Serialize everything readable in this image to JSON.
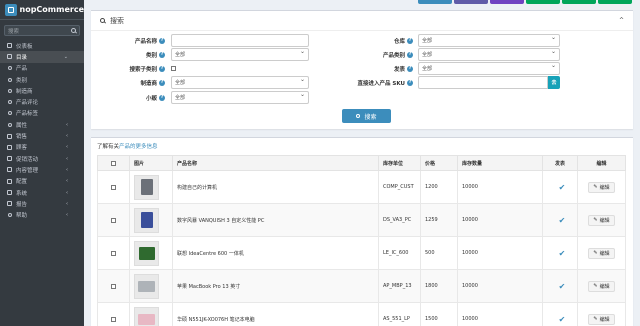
{
  "brand": {
    "name": "nopCommerce"
  },
  "sidebar": {
    "search_placeholder": "搜索",
    "items": [
      {
        "label": "仪表板",
        "chevron": ""
      },
      {
        "label": "目录",
        "chevron": "⌄"
      },
      {
        "label": "产品",
        "chevron": ""
      },
      {
        "label": "类别",
        "chevron": ""
      },
      {
        "label": "制造商",
        "chevron": ""
      },
      {
        "label": "产品评论",
        "chevron": ""
      },
      {
        "label": "产品标签",
        "chevron": ""
      },
      {
        "label": "属性",
        "chevron": "‹"
      },
      {
        "label": "销售",
        "chevron": "‹"
      },
      {
        "label": "顾客",
        "chevron": "‹"
      },
      {
        "label": "促销活动",
        "chevron": "‹"
      },
      {
        "label": "内容管理",
        "chevron": "‹"
      },
      {
        "label": "配置",
        "chevron": "‹"
      },
      {
        "label": "系统",
        "chevron": "‹"
      },
      {
        "label": "报告",
        "chevron": "‹"
      },
      {
        "label": "帮助",
        "chevron": "‹"
      }
    ]
  },
  "topbar_colors": [
    "#3c8dbc",
    "#605ca8",
    "#6f42c1",
    "#00a65a",
    "#00a65a",
    "#00a65a"
  ],
  "search": {
    "title": "搜索",
    "collapse_icon": "^",
    "help_glyph": "?",
    "fields": {
      "product_name": {
        "label": "产品名称",
        "value": ""
      },
      "category": {
        "label": "类别",
        "value": "全部"
      },
      "search_subcategories": {
        "label": "搜索子类别"
      },
      "manufacturer": {
        "label": "制造商",
        "value": "全部"
      },
      "vendor": {
        "label": "小贩",
        "value": "全部"
      },
      "warehouse": {
        "label": "仓库",
        "value": "全部"
      },
      "product_type": {
        "label": "产品类别",
        "value": "全部"
      },
      "published": {
        "label": "发表",
        "value": "全部"
      },
      "go_sku": {
        "label": "直接进入产品 SKU",
        "value": "",
        "button": "去"
      }
    },
    "button_label": "搜索"
  },
  "learn_more": {
    "prefix": "了解有关",
    "link": "产品的更多信息"
  },
  "table": {
    "columns": [
      "",
      "图片",
      "产品名称",
      "库存单位",
      "价格",
      "库存数量",
      "发表",
      "编辑"
    ],
    "edit_label": "编辑",
    "published_mark": "✔",
    "rows": [
      {
        "name": "构建自己的计算机",
        "sku": "COMP_CUST",
        "price": "1200",
        "stock": "10000",
        "published": true
      },
      {
        "name": "数字风暴 VANQUISH 3 自定义性能 PC",
        "sku": "DS_VA3_PC",
        "price": "1259",
        "stock": "10000",
        "published": true
      },
      {
        "name": "联想 IdeaCentre 600 一体机",
        "sku": "LE_IC_600",
        "price": "500",
        "stock": "10000",
        "published": true
      },
      {
        "name": "苹果 MacBook Pro 13 英寸",
        "sku": "AP_MBP_13",
        "price": "1800",
        "stock": "10000",
        "published": true
      },
      {
        "name": "华硕 N551JK-XO076H 笔记本电脑",
        "sku": "AS_551_LP",
        "price": "1500",
        "stock": "10000",
        "published": true
      }
    ]
  }
}
